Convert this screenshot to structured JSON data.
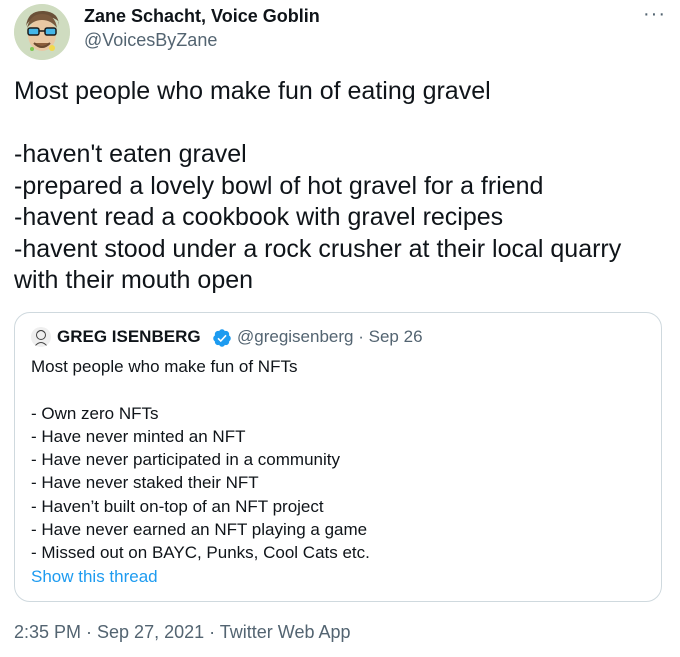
{
  "author": {
    "name": "Zane Schacht, Voice Goblin",
    "handle": "@VoicesByZane"
  },
  "tweet": {
    "lines": [
      "Most people who make fun of eating gravel",
      "",
      "-haven't eaten gravel",
      "-prepared a lovely bowl of hot gravel for a friend",
      "-havent read a cookbook with gravel recipes",
      "-havent stood under a rock crusher at their local quarry",
      "with their mouth open"
    ]
  },
  "quoted_tweet": {
    "name": "GREG ISENBERG",
    "handle": "@gregisenberg",
    "separator": "·",
    "date": "Sep 26",
    "lines": [
      "Most people who make fun of NFTs",
      "",
      "- Own zero NFTs",
      "- Have never minted an NFT",
      "- Have never participated in a community",
      "- Have never staked their NFT",
      "- Haven’t built on-top of an NFT project",
      "- Have never earned an NFT playing a game",
      "- Missed out on BAYC, Punks, Cool Cats etc."
    ],
    "show_thread": "Show this thread"
  },
  "timestamp": "2:35 PM · Sep 27, 2021 · Twitter Web App",
  "more_label": "···",
  "icons": {
    "avatar": "user-avatar-icon",
    "verified": "verified-badge-icon",
    "more": "more-options-icon"
  },
  "colors": {
    "text": "#0f1419",
    "secondary": "#536471",
    "link": "#1d9bf0",
    "border": "#cfd9de"
  }
}
